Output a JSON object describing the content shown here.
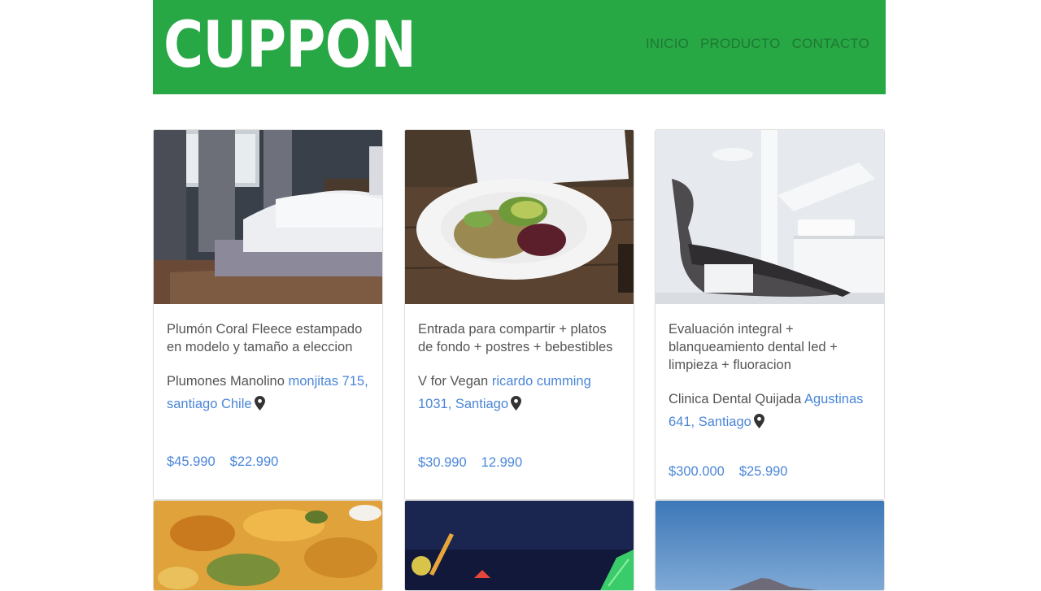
{
  "header": {
    "brand": "CUPPON",
    "nav": [
      "INICIO",
      "PRODUCTO",
      "CONTACTO"
    ]
  },
  "cards": [
    {
      "title": "Plumón Coral Fleece estampado en modelo y tamaño a eleccion",
      "merchant": "Plumones Manolino",
      "address": "monjitas 715, santiago Chile",
      "price_original": "$45.990",
      "price_offer": "$22.990"
    },
    {
      "title": "Entrada para compartir + platos de fondo + postres + bebestibles",
      "merchant": "V for Vegan",
      "address": "ricardo cumming 1031, Santiago",
      "price_original": "$30.990",
      "price_offer": "12.990"
    },
    {
      "title": "Evaluación integral + blanqueamiento dental led + limpieza + fluoracion",
      "merchant": "Clinica Dental Quijada",
      "address": "Agustinas 641, Santiago",
      "price_original": "$300.000",
      "price_offer": "$25.990"
    }
  ],
  "colors": {
    "brand_green": "#28a745",
    "nav_text": "#1d7a32",
    "link_blue": "#4a86d8",
    "body_text": "#555555"
  },
  "icons": [
    "map-pin-icon"
  ]
}
